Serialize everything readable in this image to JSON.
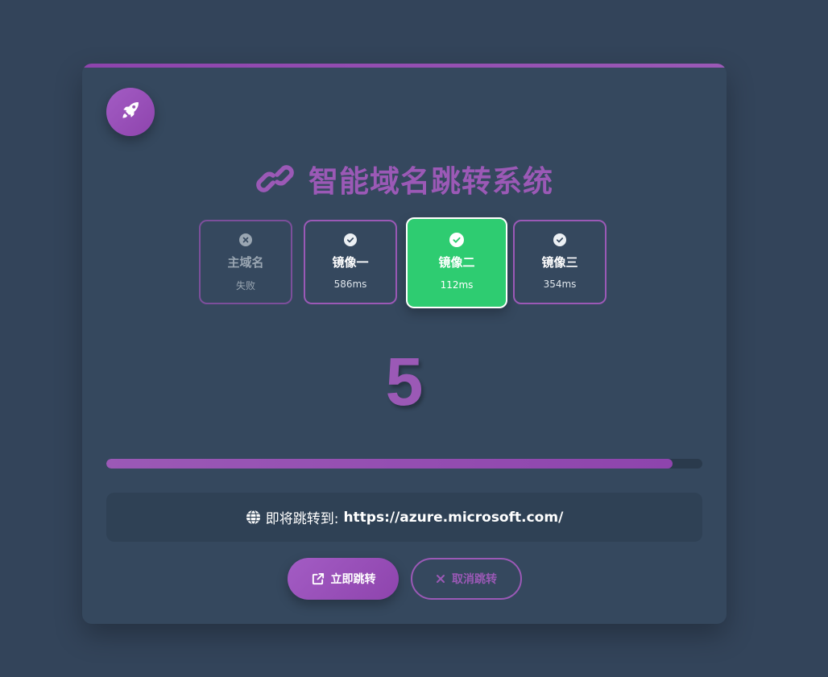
{
  "title": "智能域名跳转系统",
  "logo_icon": "rocket-icon",
  "mirrors": [
    {
      "name": "主域名",
      "value": "失败",
      "status": "failed",
      "icon": "x-circle-icon"
    },
    {
      "name": "镜像一",
      "value": "586ms",
      "status": "ok",
      "icon": "check-circle-icon"
    },
    {
      "name": "镜像二",
      "value": "112ms",
      "status": "active",
      "icon": "check-circle-icon"
    },
    {
      "name": "镜像三",
      "value": "354ms",
      "status": "ok",
      "icon": "check-circle-icon"
    }
  ],
  "countdown": "5",
  "progress_percent": 95,
  "target": {
    "label": "即将跳转到:",
    "url": "https://azure.microsoft.com/"
  },
  "buttons": {
    "go_label": "立即跳转",
    "cancel_label": "取消跳转"
  },
  "colors": {
    "accent": "#9b59b6",
    "success": "#2ecc71",
    "background": "#33445a",
    "card": "#35485e"
  }
}
